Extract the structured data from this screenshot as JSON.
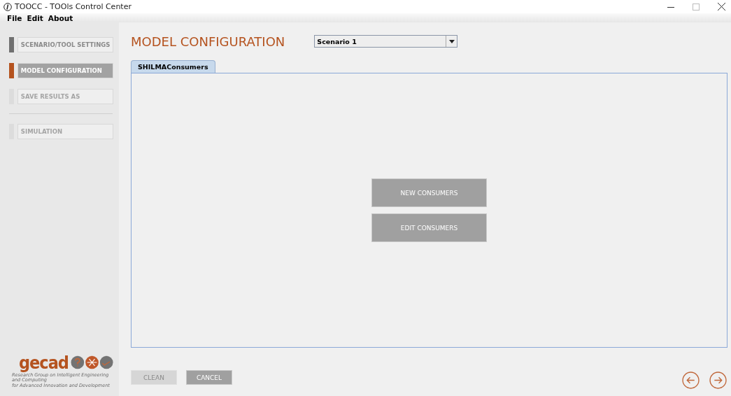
{
  "window": {
    "title": "TOOCC - TOOls Control Center"
  },
  "menu": [
    "File",
    "Edit",
    "About"
  ],
  "sidebar": {
    "groups": [
      [
        {
          "label": "SCENARIO/TOOL SETTINGS",
          "selected": false,
          "disabled": false
        },
        {
          "label": "MODEL CONFIGURATION",
          "selected": true,
          "disabled": false
        },
        {
          "label": "SAVE RESULTS AS",
          "selected": false,
          "disabled": true
        }
      ],
      [
        {
          "label": "SIMULATION",
          "selected": false,
          "disabled": true
        }
      ]
    ],
    "logo": {
      "name": "gecad",
      "tagline": [
        "Research Group on Intelligent Engineering and Computing",
        "for Advanced Innovation and Development"
      ]
    }
  },
  "page_title": "MODEL CONFIGURATION",
  "scenario_dropdown": {
    "value": "Scenario 1"
  },
  "tabs": [
    {
      "label": "SHILMAConsumers",
      "selected": true
    }
  ],
  "panel_buttons": [
    "NEW CONSUMERS",
    "EDIT CONSUMERS"
  ],
  "footer_buttons": [
    {
      "label": "CLEAN",
      "disabled": true
    },
    {
      "label": "CANCEL",
      "disabled": false
    }
  ],
  "nav": [
    {
      "kind": "back"
    },
    {
      "kind": "next"
    }
  ]
}
